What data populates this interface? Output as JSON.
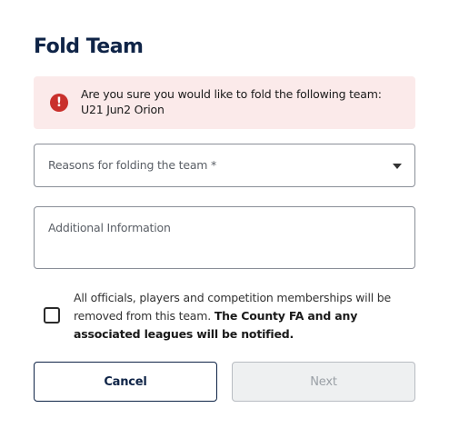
{
  "dialog": {
    "title": "Fold Team",
    "alert": {
      "icon": "exclamation-circle-icon",
      "text": "Are you sure you would like to fold the following team: U21 Jun2 Orion"
    },
    "reason_select": {
      "label": "Reasons for folding the team *"
    },
    "additional_info": {
      "placeholder": "Additional Information"
    },
    "confirm_checkbox": {
      "checked": false,
      "text_plain": "All officials, players and competition memberships will be removed from this team.",
      "text_bold": "The County FA and any associated leagues will be notified."
    },
    "buttons": {
      "cancel": "Cancel",
      "next": "Next"
    }
  },
  "colors": {
    "title": "#0f2447",
    "alert_bg": "#fbeaea",
    "alert_icon": "#c9302c",
    "disabled_button_bg": "#eef0f1"
  }
}
